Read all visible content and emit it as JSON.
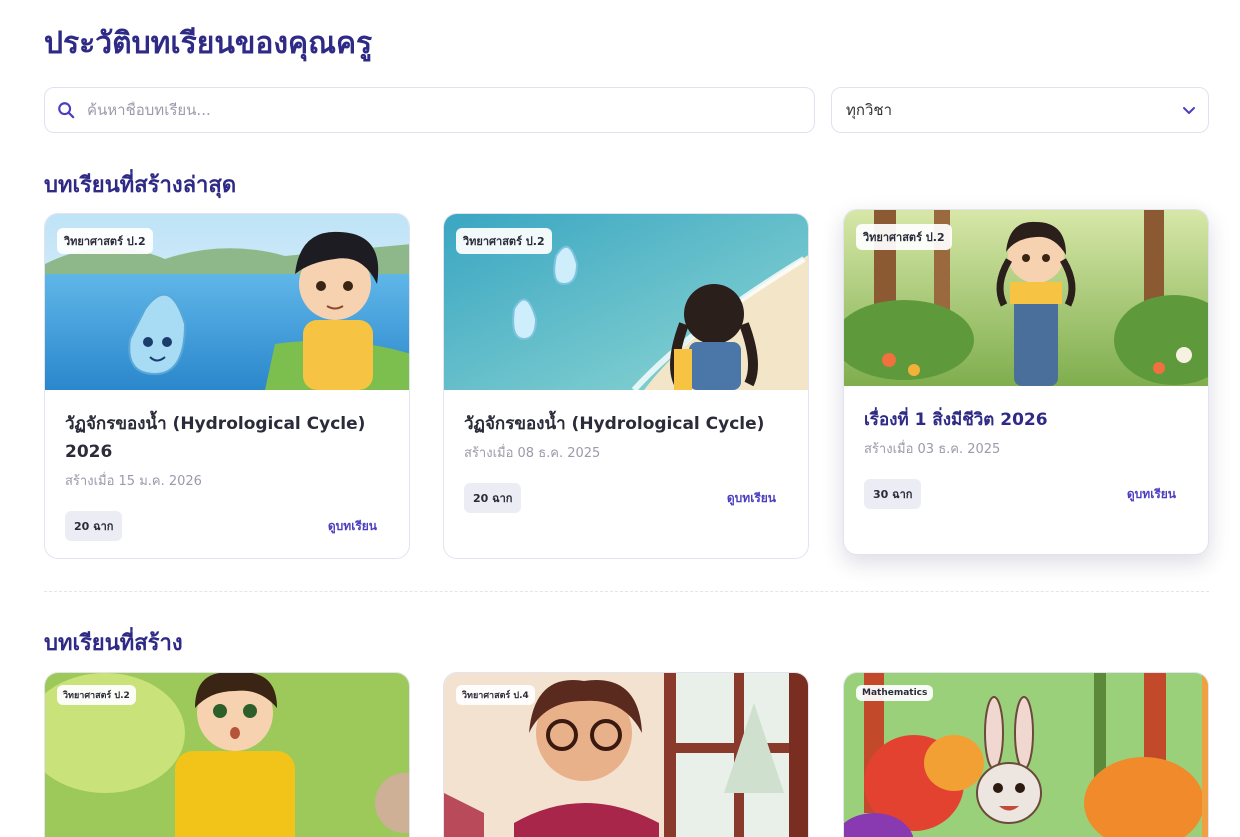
{
  "header": {
    "title": "ประวัติบทเรียนของคุณครู"
  },
  "search": {
    "placeholder": "ค้นหาชื่อบทเรียน...",
    "value": ""
  },
  "filter": {
    "selected": "ทุกวิชา"
  },
  "sections": {
    "latest": {
      "title": "บทเรียนที่สร้างล่าสุด",
      "cards": [
        {
          "badge": "วิทยาศาสตร์ ป.2",
          "title": "วัฏจักรของน้ำ (Hydrological Cycle) 2026",
          "date": "สร้างเมื่อ 15 ม.ค. 2026",
          "scenes": "20 ฉาก",
          "action": "ดูบทเรียน"
        },
        {
          "badge": "วิทยาศาสตร์ ป.2",
          "title": "วัฏจักรของน้ำ (Hydrological Cycle)",
          "date": "สร้างเมื่อ 08 ธ.ค. 2025",
          "scenes": "20 ฉาก",
          "action": "ดูบทเรียน"
        },
        {
          "badge": "วิทยาศาสตร์ ป.2",
          "title": "เรื่องที่ 1 สิ่งมีชีวิต 2026",
          "date": "สร้างเมื่อ 03 ธ.ค. 2025",
          "scenes": "30 ฉาก",
          "action": "ดูบทเรียน"
        }
      ]
    },
    "created": {
      "title": "บทเรียนที่สร้าง",
      "cards": [
        {
          "badge": "วิทยาศาสตร์ ป.2"
        },
        {
          "badge": "วิทยาศาสตร์ ป.4"
        },
        {
          "badge": "Mathematics"
        }
      ]
    }
  },
  "colors": {
    "accent": "#2e2a86",
    "link": "#4b3fbf"
  },
  "icons": {
    "search": "search-icon",
    "dropdown": "chevron-down-icon"
  }
}
